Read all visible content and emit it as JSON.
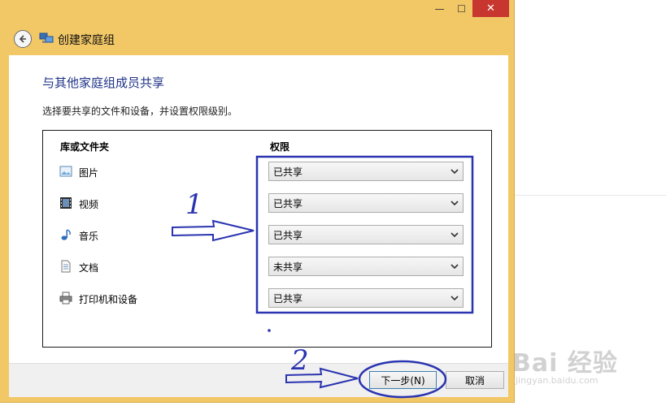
{
  "window": {
    "title": "创建家庭组",
    "controls": {
      "minimize": "—",
      "maximize": "☐",
      "close": "✕"
    },
    "accent_color": "#f2c766"
  },
  "content": {
    "heading": "与其他家庭组成员共享",
    "description": "选择要共享的文件和设备，并设置权限级别。"
  },
  "table": {
    "columns": [
      "库或文件夹",
      "权限"
    ],
    "rows": [
      {
        "icon": "pictures-icon",
        "label": "图片",
        "permission": "已共享"
      },
      {
        "icon": "videos-icon",
        "label": "视频",
        "permission": "已共享"
      },
      {
        "icon": "music-icon",
        "label": "音乐",
        "permission": "已共享"
      },
      {
        "icon": "documents-icon",
        "label": "文档",
        "permission": "未共享"
      },
      {
        "icon": "printer-icon",
        "label": "打印机和设备",
        "permission": "已共享"
      }
    ]
  },
  "footer": {
    "next_label": "下一步(N)",
    "cancel_label": "取消"
  },
  "annotations": {
    "label_1": "1",
    "label_2": "2",
    "color": "#2a34b0"
  },
  "watermark": {
    "brand": "Bai 经验",
    "url": "jingyan.baidu.com"
  }
}
